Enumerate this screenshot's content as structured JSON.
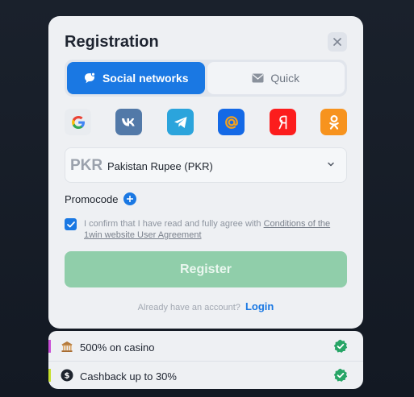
{
  "modal": {
    "title": "Registration",
    "close_icon": "close-icon"
  },
  "tabs": [
    {
      "label": "Social networks",
      "icon": "chat-bubble-icon",
      "active": true
    },
    {
      "label": "Quick",
      "icon": "envelope-icon",
      "active": false
    }
  ],
  "social_buttons": [
    {
      "name": "google",
      "color": "#ffffff"
    },
    {
      "name": "vk",
      "color": "#5279a8"
    },
    {
      "name": "telegram",
      "color": "#2ba4dc"
    },
    {
      "name": "mail-ru",
      "color": "#1469e6"
    },
    {
      "name": "yandex",
      "color": "#fc1d1d"
    },
    {
      "name": "odnoklassniki",
      "color": "#f7931e"
    }
  ],
  "currency": {
    "code": "PKR",
    "name": "Pakistan Rupee (PKR)"
  },
  "promocode": {
    "label": "Promocode"
  },
  "agreement": {
    "checked": true,
    "text_prefix": "I confirm that I have read and fully agree with ",
    "link_text": "Conditions of the 1win website User Agreement"
  },
  "register_button": {
    "label": "Register",
    "color": "#90ceaa"
  },
  "login_prompt": {
    "text": "Already have an account?",
    "link": "Login"
  },
  "bonuses": [
    {
      "text": "500% on casino",
      "stripe_color": "#c94fd6",
      "icon": "casino-icon"
    },
    {
      "text": "Cashback up to 30%",
      "stripe_color": "#c6e02c",
      "icon": "cashback-icon"
    }
  ],
  "colors": {
    "accent": "#1a78e3",
    "success": "#27a566"
  }
}
